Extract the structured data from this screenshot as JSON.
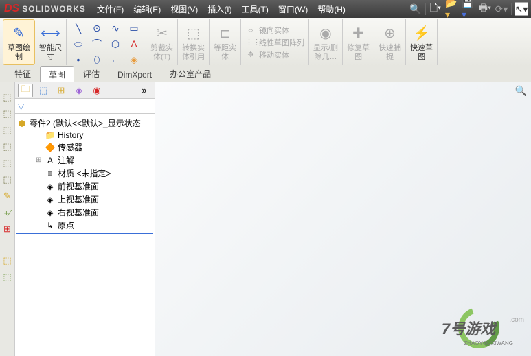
{
  "title": {
    "logo": "SOLIDWORKS"
  },
  "menu": [
    "文件(F)",
    "编辑(E)",
    "视图(V)",
    "插入(I)",
    "工具(T)",
    "窗口(W)",
    "帮助(H)"
  ],
  "ribbon": {
    "sketch": "草图绘\n制",
    "smartdim": "智能尺\n寸",
    "trim": "剪裁实\n体(T)",
    "convert": "转换实\n体引用",
    "offset": "等距实\n体",
    "mirror": "镜向实体",
    "linpattern": "线性草图阵列",
    "move": "移动实体",
    "showdel": "显示/删\n除几…",
    "repair": "修复草\n图",
    "quicksnap": "快速捕\n捉",
    "rapidsketch": "快速草\n图"
  },
  "tabs": [
    "特征",
    "草图",
    "评估",
    "DimXpert",
    "办公室产品"
  ],
  "activeTab": 1,
  "tree": {
    "root": "零件2  (默认<<默认>_显示状态",
    "items": [
      {
        "icon": "📁",
        "label": "History"
      },
      {
        "icon": "🔶",
        "label": "传感器"
      },
      {
        "icon": "A",
        "label": "注解",
        "expandable": true
      },
      {
        "icon": "≡",
        "label": "材质 <未指定>"
      },
      {
        "icon": "◈",
        "label": "前视基准面"
      },
      {
        "icon": "◈",
        "label": "上视基准面"
      },
      {
        "icon": "◈",
        "label": "右视基准面"
      },
      {
        "icon": "↳",
        "label": "原点",
        "last": true
      }
    ]
  },
  "watermark": {
    "main": "7号游戏",
    "sub": "ZHAOYOUXIWANG",
    "url": ".com",
    "extra": "游戏"
  }
}
